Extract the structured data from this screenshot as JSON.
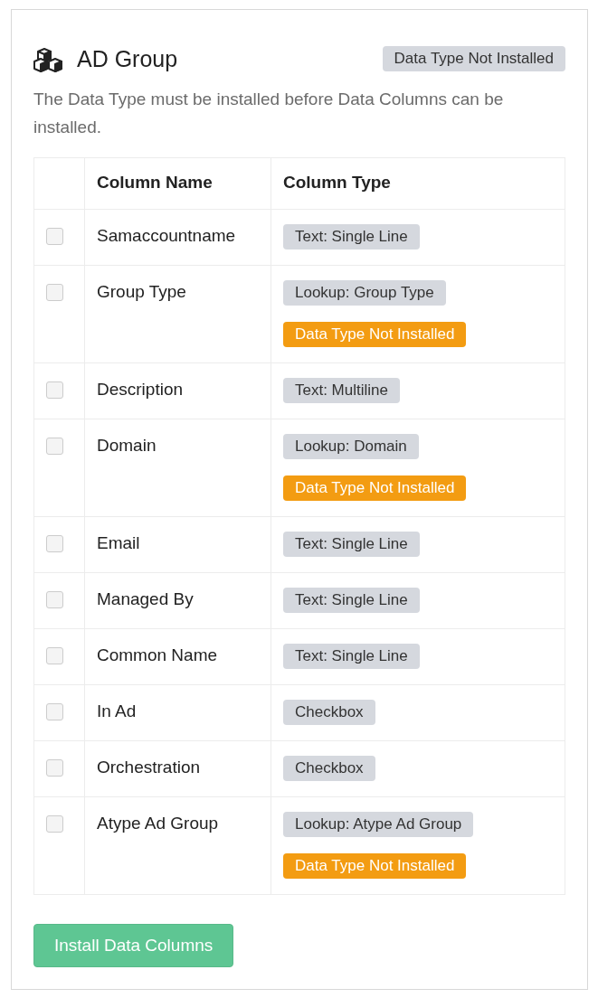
{
  "card": {
    "title": "AD Group",
    "status_badge": "Data Type Not Installed",
    "message": "The Data Type must be installed before Data Columns can be installed."
  },
  "table": {
    "columns": [
      "Column Name",
      "Column Type"
    ],
    "rows": [
      {
        "checked": false,
        "name": "Samaccountname",
        "badges": [
          {
            "kind": "type",
            "text": "Text: Single Line"
          }
        ]
      },
      {
        "checked": false,
        "name": "Group Type",
        "badges": [
          {
            "kind": "type",
            "text": "Lookup: Group Type"
          },
          {
            "kind": "warning",
            "text": "Data Type Not Installed"
          }
        ]
      },
      {
        "checked": false,
        "name": "Description",
        "badges": [
          {
            "kind": "type",
            "text": "Text: Multiline"
          }
        ]
      },
      {
        "checked": false,
        "name": "Domain",
        "badges": [
          {
            "kind": "type",
            "text": "Lookup: Domain"
          },
          {
            "kind": "warning",
            "text": "Data Type Not Installed"
          }
        ]
      },
      {
        "checked": false,
        "name": "Email",
        "badges": [
          {
            "kind": "type",
            "text": "Text: Single Line"
          }
        ]
      },
      {
        "checked": false,
        "name": "Managed By",
        "badges": [
          {
            "kind": "type",
            "text": "Text: Single Line"
          }
        ]
      },
      {
        "checked": false,
        "name": "Common Name",
        "badges": [
          {
            "kind": "type",
            "text": "Text: Single Line"
          }
        ]
      },
      {
        "checked": false,
        "name": "In Ad",
        "badges": [
          {
            "kind": "type",
            "text": "Checkbox"
          }
        ]
      },
      {
        "checked": false,
        "name": "Orchestration",
        "badges": [
          {
            "kind": "type",
            "text": "Checkbox"
          }
        ]
      },
      {
        "checked": false,
        "name": "Atype Ad Group",
        "badges": [
          {
            "kind": "type",
            "text": "Lookup: Atype Ad Group"
          },
          {
            "kind": "warning",
            "text": "Data Type Not Installed"
          }
        ]
      }
    ]
  },
  "install_button": {
    "label": "Install Data Columns",
    "disabled": true
  }
}
